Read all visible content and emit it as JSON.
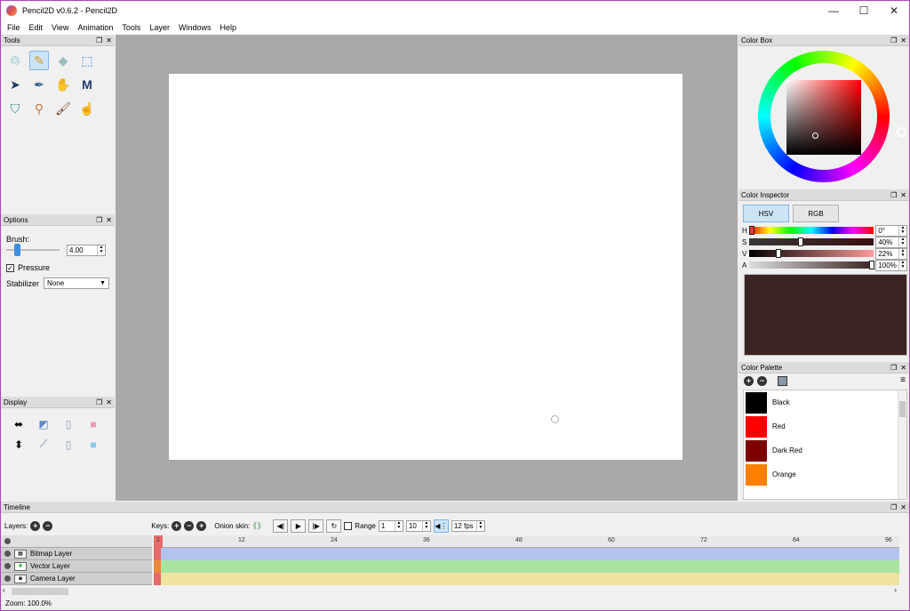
{
  "window": {
    "title": "Pencil2D v0.6.2 - Pencil2D",
    "minimize": "—",
    "maximize": "☐",
    "close": "✕"
  },
  "menu": [
    "File",
    "Edit",
    "View",
    "Animation",
    "Tools",
    "Layer",
    "Windows",
    "Help"
  ],
  "panels": {
    "tools": {
      "title": "Tools"
    },
    "options": {
      "title": "Options",
      "brush_label": "Brush:",
      "brush_value": "4.00",
      "pressure_label": "Pressure",
      "stabilizer_label": "Stabilizer",
      "stabilizer_value": "None"
    },
    "display": {
      "title": "Display"
    },
    "color_box": {
      "title": "Color Box"
    },
    "color_inspector": {
      "title": "Color Inspector",
      "mode_hsv": "HSV",
      "mode_rgb": "RGB",
      "h_label": "H",
      "h_value": "0°",
      "s_label": "S",
      "s_value": "40%",
      "v_label": "V",
      "v_value": "22%",
      "a_label": "A",
      "a_value": "100%",
      "preview_color": "#3a2423"
    },
    "color_palette": {
      "title": "Color Palette",
      "items": [
        {
          "name": "Black",
          "color": "#000000"
        },
        {
          "name": "Red",
          "color": "#ff0000"
        },
        {
          "name": "Dark Red",
          "color": "#7f0000"
        },
        {
          "name": "Orange",
          "color": "#ff7f00"
        }
      ]
    },
    "timeline": {
      "title": "Timeline",
      "layers_label": "Layers:",
      "keys_label": "Keys:",
      "onion_label": "Onion skin:",
      "range_label": "Range",
      "range_start": "1",
      "range_end": "10",
      "fps": "12 fps",
      "layers": [
        "Bitmap Layer",
        "Vector Layer",
        "Camera Layer"
      ],
      "ruler_marks": [
        "1",
        "12",
        "24",
        "36",
        "48",
        "60",
        "72",
        "84",
        "96"
      ]
    }
  },
  "status": {
    "zoom": "Zoom: 100.0%"
  }
}
